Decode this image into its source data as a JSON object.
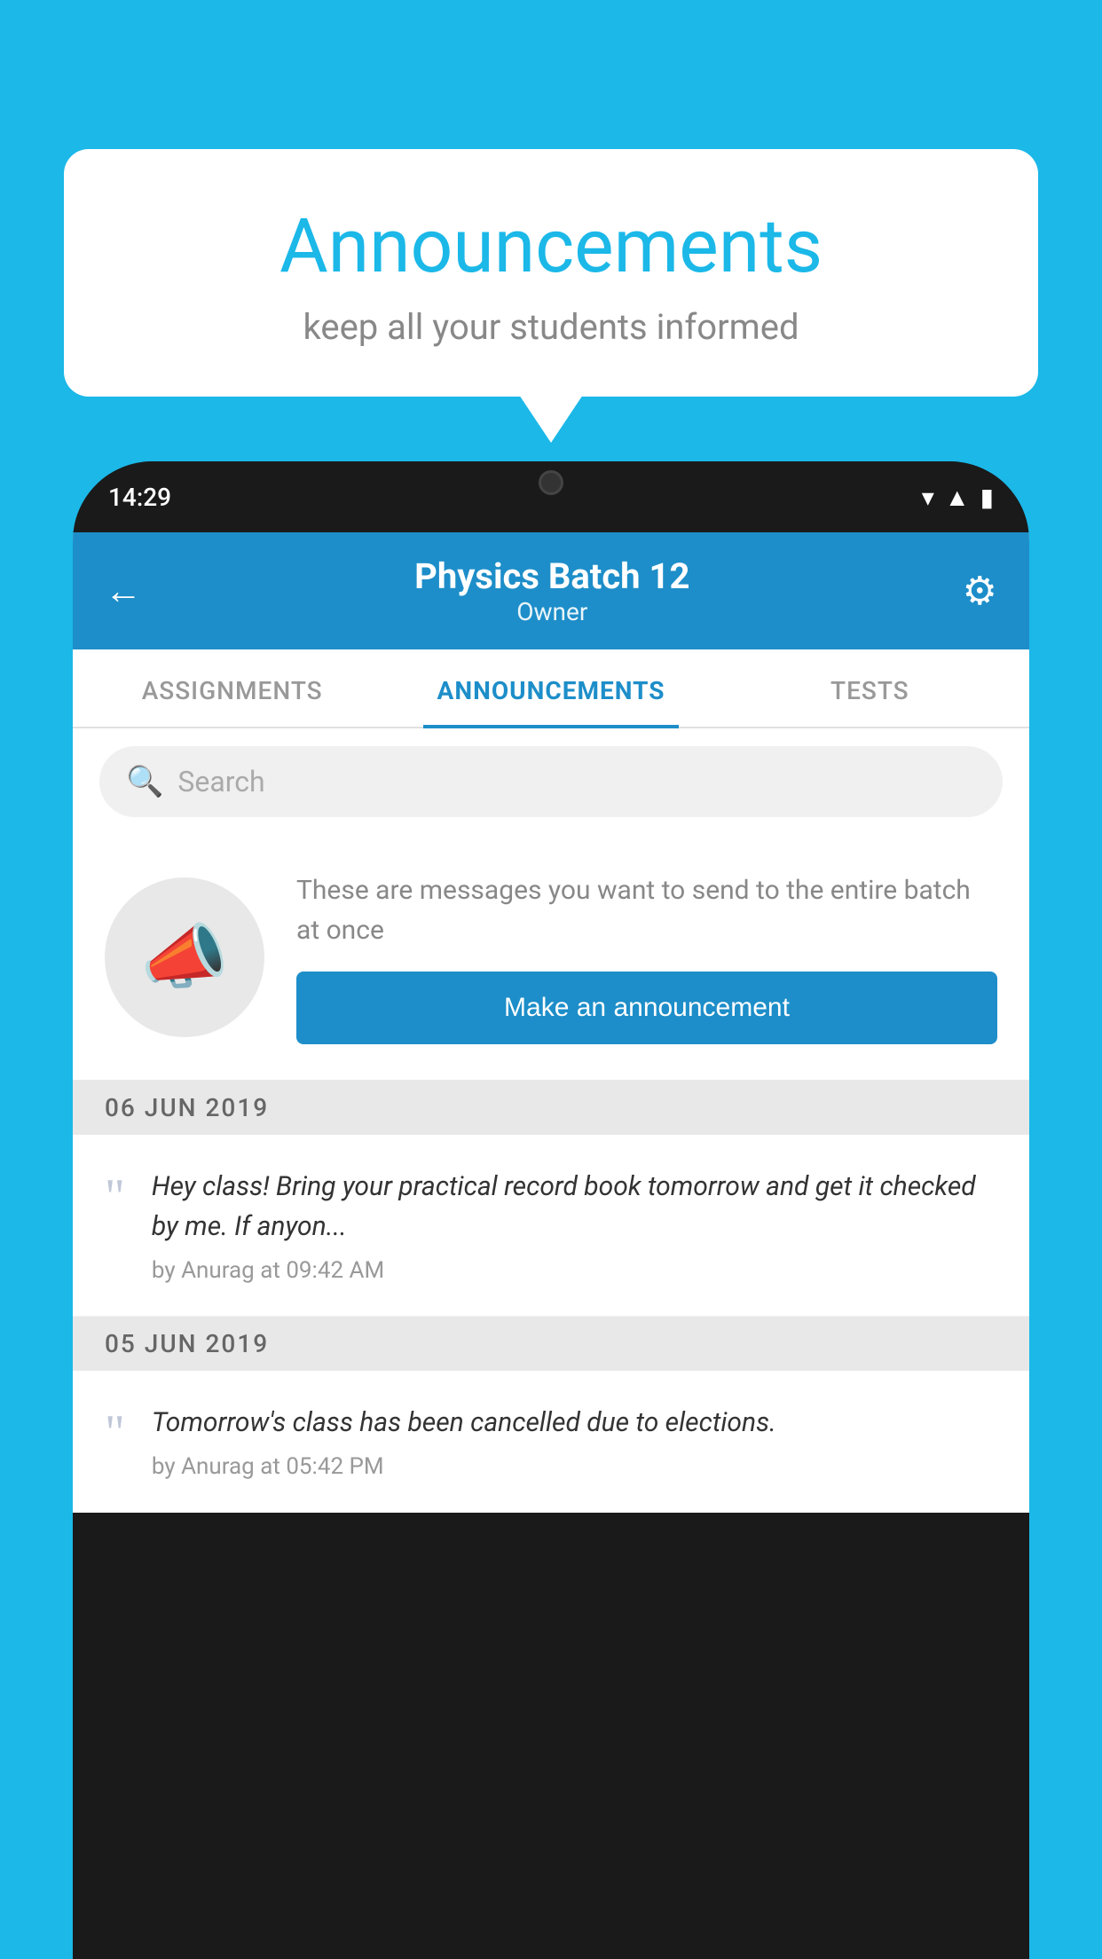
{
  "background_color": "#1bb8e8",
  "speech_bubble": {
    "title": "Announcements",
    "subtitle": "keep all your students informed"
  },
  "phone": {
    "status_bar": {
      "time": "14:29",
      "icons": [
        "wifi",
        "signal",
        "battery"
      ]
    },
    "header": {
      "title": "Physics Batch 12",
      "subtitle": "Owner",
      "back_label": "←",
      "gear_label": "⚙"
    },
    "tabs": [
      {
        "label": "ASSIGNMENTS",
        "active": false
      },
      {
        "label": "ANNOUNCEMENTS",
        "active": true
      },
      {
        "label": "TESTS",
        "active": false
      }
    ],
    "search": {
      "placeholder": "Search"
    },
    "promo": {
      "description": "These are messages you want to send to the entire batch at once",
      "button_label": "Make an announcement"
    },
    "announcements": [
      {
        "date": "06  JUN  2019",
        "text": "Hey class! Bring your practical record book tomorrow and get it checked by me. If anyon...",
        "meta": "by Anurag at 09:42 AM"
      },
      {
        "date": "05  JUN  2019",
        "text": "Tomorrow's class has been cancelled due to elections.",
        "meta": "by Anurag at 05:42 PM"
      }
    ]
  }
}
